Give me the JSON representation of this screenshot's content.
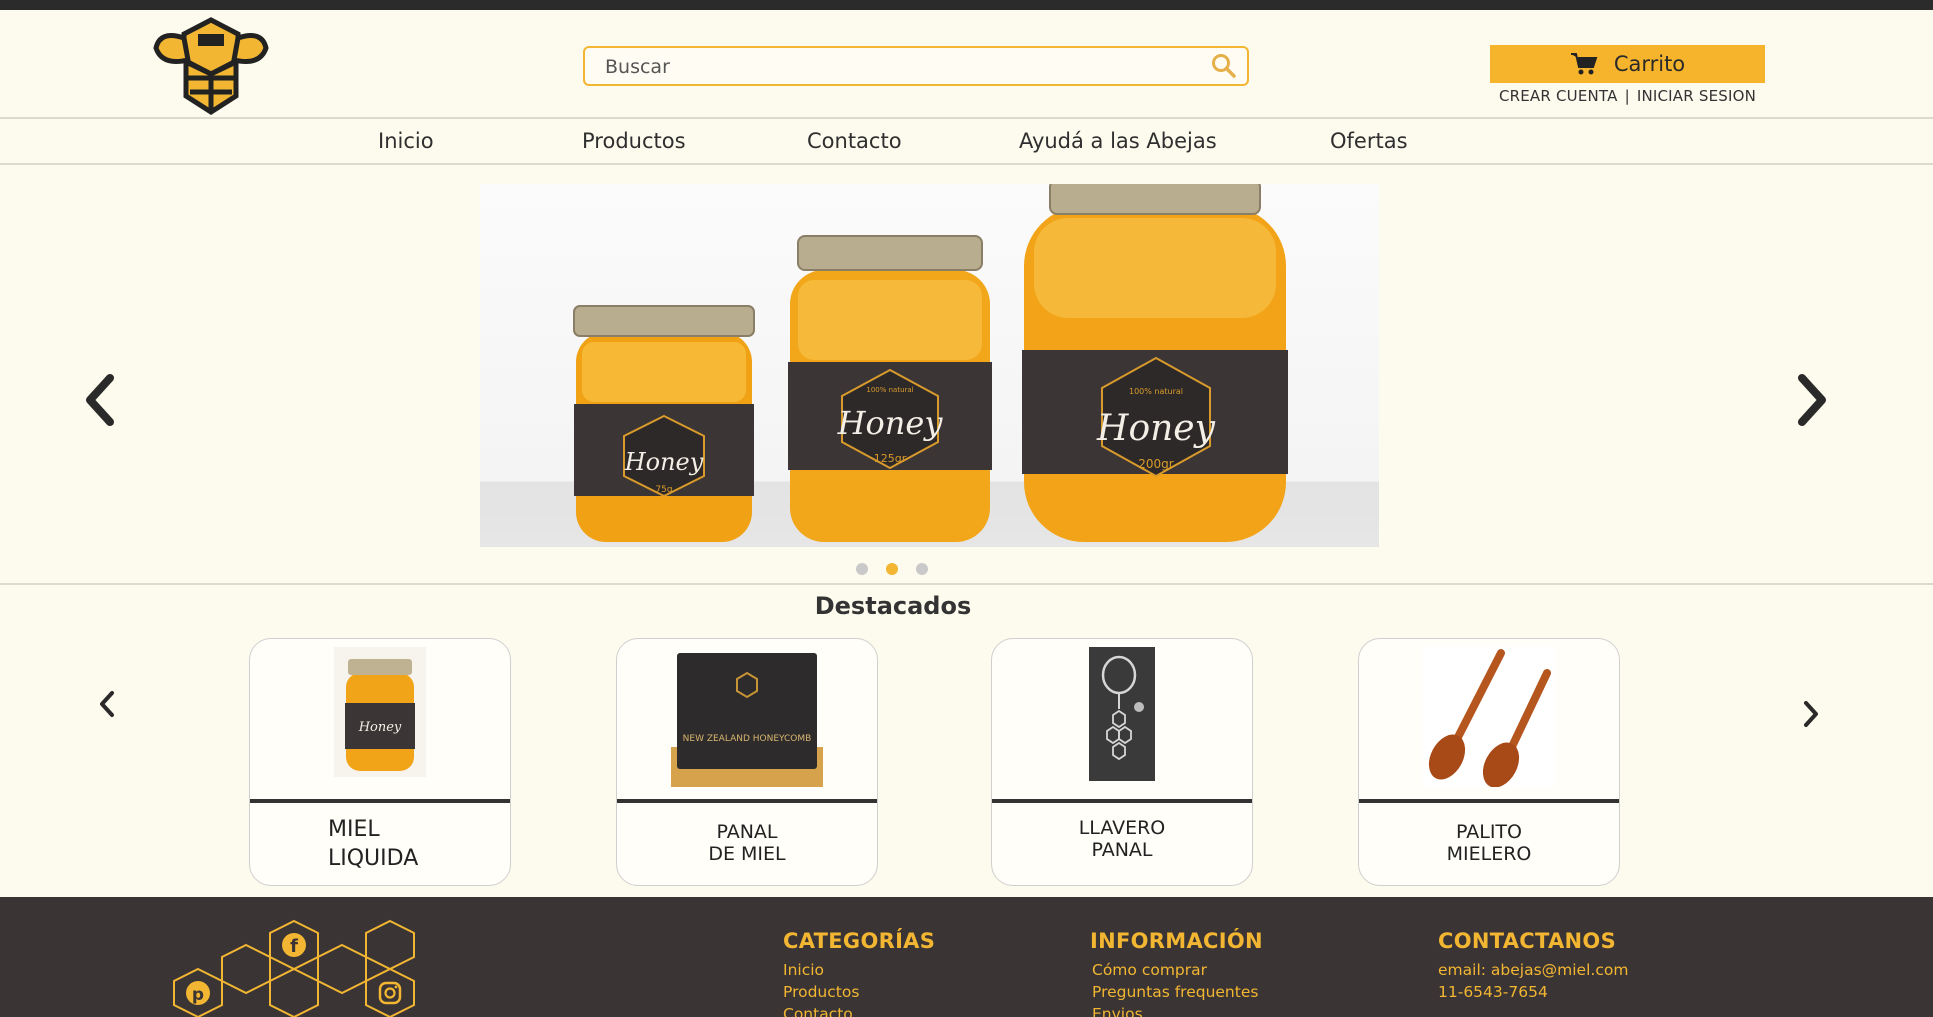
{
  "header": {
    "search_placeholder": "Buscar",
    "cart_label": "Carrito",
    "create_account": "CREAR CUENTA",
    "separator": "|",
    "login": "INICIAR SESION"
  },
  "nav": [
    "Inicio",
    "Productos",
    "Contacto",
    "Ayudá a las Abejas",
    "Ofertas"
  ],
  "hero": {
    "jars": [
      {
        "brand": "Honey",
        "weight": "75g"
      },
      {
        "brand": "Honey",
        "weight": "125gr",
        "tagline": "100% natural"
      },
      {
        "brand": "Honey",
        "weight": "200gr",
        "tagline": "100% natural"
      }
    ],
    "active_slide": 2,
    "slide_count": 3
  },
  "featured": {
    "title": "Destacados",
    "products": [
      {
        "label": "MIEL\nLIQUIDA",
        "icon": "honey-jar",
        "image_text": "Honey"
      },
      {
        "label": "PANAL\nDE MIEL",
        "icon": "honeycomb-box",
        "image_text": "NEW ZEALAND HONEYCOMB"
      },
      {
        "label": "LLAVERO\nPANAL",
        "icon": "keychain"
      },
      {
        "label": "PALITO\nMIELERO",
        "icon": "honey-dipper"
      }
    ]
  },
  "footer": {
    "categorias": {
      "title": "CATEGORÍAS",
      "links": [
        "Inicio",
        "Productos",
        "Contacto"
      ]
    },
    "informacion": {
      "title": "INFORMACIÓN",
      "links": [
        "Cómo comprar",
        "Preguntas frequentes",
        "Envios"
      ]
    },
    "contactanos": {
      "title": "CONTACTANOS",
      "email": "email: abejas@miel.com",
      "phone": "11-6543-7654"
    },
    "social": [
      "facebook-icon",
      "pinterest-icon",
      "instagram-icon"
    ]
  },
  "colors": {
    "accent": "#f2b632",
    "background": "#fdfbee",
    "footer": "#3a3434"
  }
}
